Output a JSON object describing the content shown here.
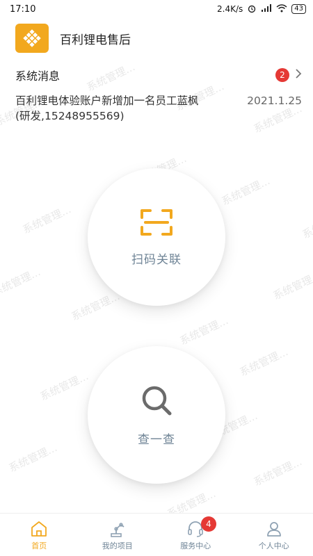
{
  "status_bar": {
    "time": "17:10",
    "net_speed": "2.4K/s",
    "battery": "43"
  },
  "header": {
    "app_title": "百利锂电售后"
  },
  "messages": {
    "title": "系统消息",
    "badge_count": "2",
    "line1": "百利锂电体验账户新增加一名员工蓝枫",
    "date": "2021.1.25",
    "line2": "(研发,15248955569)"
  },
  "actions": {
    "scan_label": "扫码关联",
    "search_label": "查一查"
  },
  "watermark": "系统管理...",
  "bottom_nav": {
    "home": "首页",
    "projects": "我的项目",
    "service": "服务中心",
    "service_badge": "4",
    "profile": "个人中心"
  },
  "colors": {
    "accent": "#f2a81e",
    "badge": "#e53935",
    "muted": "#6f8496"
  }
}
